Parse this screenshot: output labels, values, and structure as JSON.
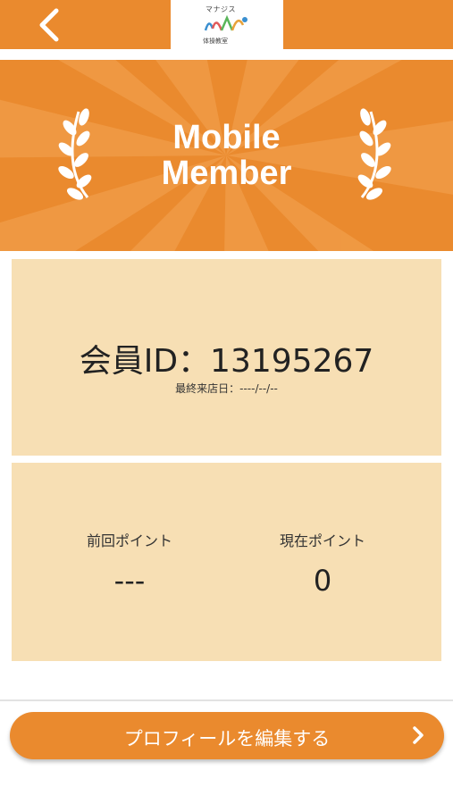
{
  "header": {
    "back_icon": "chevron-left-icon",
    "logo": {
      "top_text": "マナジス",
      "bottom_text": "体操教室"
    }
  },
  "banner": {
    "title_line1": "Mobile",
    "title_line2": "Member",
    "icons": [
      "laurel-icon",
      "laurel-icon"
    ]
  },
  "member": {
    "id_text": "会員ID：13195267",
    "last_visit": "最終来店日：----/--/--"
  },
  "points": {
    "previous_label": "前回ポイント",
    "previous_value": "---",
    "current_label": "現在ポイント",
    "current_value": "0"
  },
  "actions": {
    "edit_profile_label": "プロフィールを編集する",
    "edit_icon": "chevron-right-icon"
  },
  "colors": {
    "primary": "#ea8a2e",
    "card": "#f7dfb4",
    "text": "#222222"
  }
}
